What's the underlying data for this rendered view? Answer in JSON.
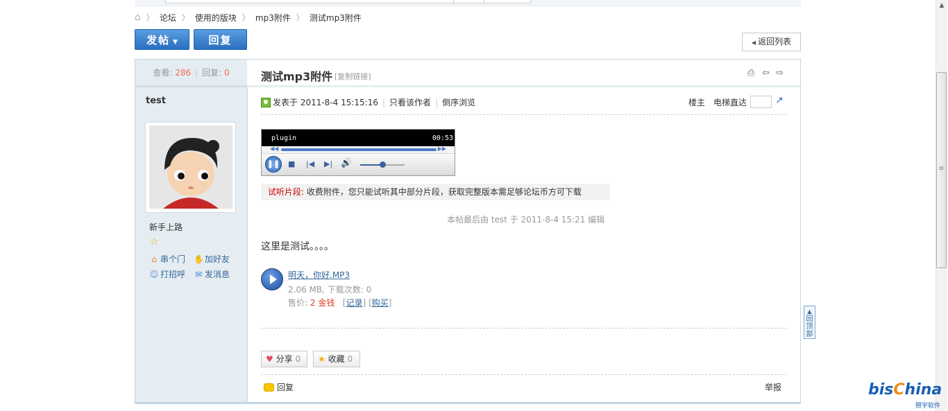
{
  "breadcrumb": {
    "home_icon": "home-icon",
    "items": [
      "论坛",
      "使用的版块",
      "mp3附件",
      "测试mp3附件"
    ]
  },
  "toolbar": {
    "post_label": "发帖",
    "post_caret": "▼",
    "reply_label": "回复",
    "back_label": "返回列表"
  },
  "stats": {
    "views_label": "查看:",
    "views": "286",
    "replies_label": "回复:",
    "replies": "0"
  },
  "thread": {
    "title": "测试mp3附件",
    "copy_link": "[复制链接]"
  },
  "author": {
    "name": "test",
    "rank": "新手上路",
    "actions": [
      {
        "label": "串个门",
        "icon": "home-icon"
      },
      {
        "label": "加好友",
        "icon": "handshake-icon"
      },
      {
        "label": "打招呼",
        "icon": "greet-icon"
      },
      {
        "label": "发消息",
        "icon": "mail-icon"
      }
    ]
  },
  "post": {
    "posted_label": "发表于 2011-8-4 15:15:16",
    "only_author": "只看该作者",
    "reverse": "倒序浏览",
    "floor": "楼主",
    "elevator": "电梯直达",
    "player": {
      "title": "plugin",
      "time": "00:53"
    },
    "preview_label": "试听片段:",
    "preview_text": "收费附件，您只能试听其中部分片段，获取完整版本需足够论坛币方可下载",
    "edit_note": "本帖最后由 test 于 2011-8-4 15:21 编辑",
    "body": "这里是测试。。。。",
    "attachment": {
      "name": "明天，你好.MP3",
      "size": "2.06 MB, 下载次数: 0",
      "price_label": "售价:",
      "price": "2 金钱",
      "record": "记录",
      "buy": "购买"
    },
    "share_label": "分享",
    "share_count": "0",
    "fav_label": "收藏",
    "fav_count": "0",
    "reply_label": "回复",
    "report_label": "举报"
  },
  "totop_label": "回顶部",
  "watermark": {
    "brand": "bisChina",
    "sub": "照宇软件"
  },
  "colors": {
    "accent": "#2a6fc0",
    "highlight": "#f26c4f",
    "sidebar_bg": "#e5edf2"
  }
}
